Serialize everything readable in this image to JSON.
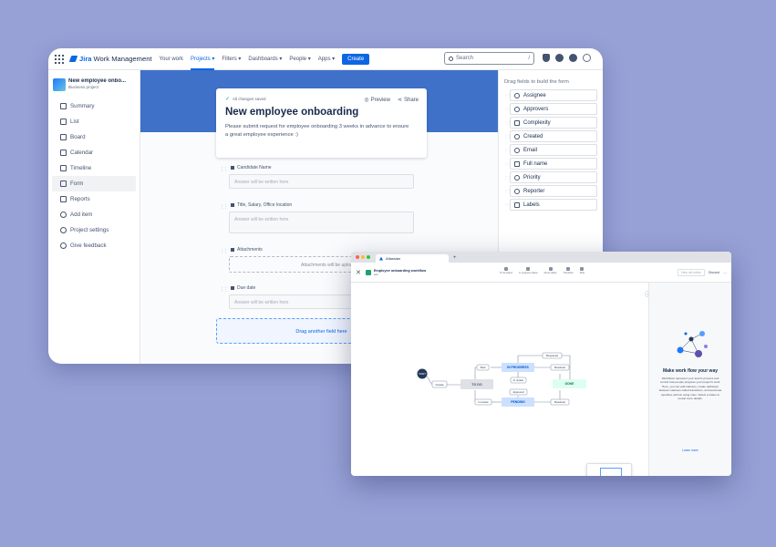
{
  "topnav": {
    "product_bold": "Jira",
    "product_rest": "Work Management",
    "items": [
      "Your work",
      "Projects ▾",
      "Filters ▾",
      "Dashboards ▾",
      "People ▾",
      "Apps ▾"
    ],
    "create_label": "Create",
    "search_placeholder": "Search",
    "search_shortcut": "/"
  },
  "project": {
    "name": "New employee onbo...",
    "type": "Business project"
  },
  "sidebar": {
    "items": [
      "Summary",
      "List",
      "Board",
      "Calendar",
      "Timeline",
      "Form",
      "Reports",
      "Add item",
      "Project settings",
      "Give feedback"
    ]
  },
  "form": {
    "saved_status": "All changes saved",
    "preview_label": "Preview",
    "share_label": "Share",
    "title": "New employee onboarding",
    "description": "Please submit request for employee onboarding 3 weeks in advance to ensure a great employee experience :)",
    "fields": [
      {
        "label": "Candidate Name",
        "placeholder": "Answer will be written here"
      },
      {
        "label": "Title, Salary, Office location",
        "placeholder": "Answer will be written here"
      },
      {
        "label": "Attachments",
        "placeholder": "Attachments will be uploaded here"
      },
      {
        "label": "Due date",
        "placeholder": "Answer will be written here"
      }
    ],
    "dropzone": "Drag another field here"
  },
  "right_panel": {
    "title": "Drag fields to build the form",
    "items": [
      "Assignee",
      "Approvers",
      "Complexity",
      "Created",
      "Email",
      "Full name",
      "Priority",
      "Reporter",
      "Labels"
    ]
  },
  "atlassian": {
    "tab_title": "Atlassian",
    "workflow_title": "Employee onboarding workflow",
    "workflow_sub": "edit",
    "tools": [
      "To do status",
      "In progress status",
      "Done status",
      "Transition",
      "Rule"
    ],
    "btn_view": "View old editor",
    "btn_discard": "Discard",
    "diagram": {
      "start": "START",
      "statuses": {
        "todo": "TO DO",
        "inprogress": "IN PROGRESS",
        "done": "DONE",
        "pending": "PENDING"
      },
      "transitions": {
        "create": "Create",
        "start": "Start",
        "reopened": "Reopened",
        "resolved_top": "Resolved",
        "in_review_mid": "In review",
        "approved": "Approved",
        "in_review_bottom": "In review",
        "resolved_bottom": "Resolved"
      }
    },
    "info": {
      "title": "Make work flow your way",
      "desc": "Workflows represent your team's process and control how people progress your project's work. Here, you can add statuses, create pathways between statuses called transitions, and automate repetitive actions using rules. Select a status to reveal more details.",
      "learn": "Learn more"
    }
  },
  "colors": {
    "brand": "#0c66e4",
    "band": "#3f71c9",
    "background": "#97a1d6"
  }
}
